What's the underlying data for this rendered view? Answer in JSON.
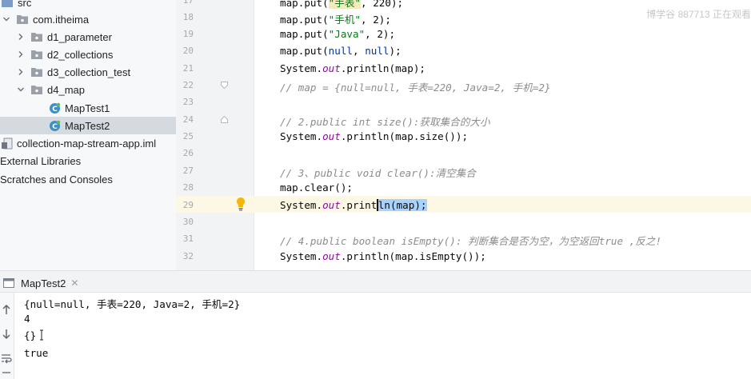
{
  "project_tree": {
    "src": "src",
    "package": "com.itheima",
    "folders": [
      "d1_parameter",
      "d2_collections",
      "d3_collection_test",
      "d4_map"
    ],
    "classes": [
      "MapTest1",
      "MapTest2"
    ],
    "iml_file": "collection-map-stream-app.iml",
    "external_libraries": "External Libraries",
    "scratches": "Scratches and Consoles"
  },
  "editor": {
    "watermark": "博学谷 887713 正在观看",
    "line_numbers": [
      "17",
      "18",
      "19",
      "20",
      "21",
      "22",
      "23",
      "24",
      "25",
      "26",
      "27",
      "28",
      "29",
      "30",
      "31",
      "32"
    ],
    "code": {
      "l17": {
        "a": "map.put(",
        "b": "\"手表\"",
        "c": ", 220);"
      },
      "l18": {
        "a": "map.put(",
        "b": "\"手机\"",
        "c": ", 2);"
      },
      "l19": {
        "a": "map.put(",
        "b": "\"Java\"",
        "c": ", 2);"
      },
      "l20": {
        "a": "map.put(",
        "b": "null",
        "c": ", ",
        "d": "null",
        "e": ");"
      },
      "l21": {
        "a": "System.",
        "b": "out",
        "c": ".println(map);"
      },
      "l22": "// map = {null=null, 手表=220, Java=2, 手机=2}",
      "l24": "// 2.public int size():获取集合的大小",
      "l25": {
        "a": "System.",
        "b": "out",
        "c": ".println(map.size());"
      },
      "l27": "// 3、public void clear():清空集合",
      "l28": "map.clear();",
      "l29": {
        "a": "System.",
        "b": "out",
        "c": ".print",
        "d": "ln(map);"
      },
      "l31": "// 4.public boolean isEmpty(): 判断集合是否为空，为空返回true ,反之!",
      "l32": {
        "a": "System.",
        "b": "out",
        "c": ".println(map.isEmpty());"
      }
    }
  },
  "run_panel": {
    "tab_label": "MapTest2",
    "output": [
      "{null=null, 手表=220, Java=2, 手机=2}",
      "4",
      "{}",
      "true"
    ]
  },
  "colors": {
    "keyword": "#0033b3",
    "field": "#871094",
    "string": "#067d17",
    "comment": "#8c8c8c",
    "selection": "#a6d2ff",
    "current_line": "#fcf8e3",
    "tree_selection": "#d5d9e0"
  }
}
